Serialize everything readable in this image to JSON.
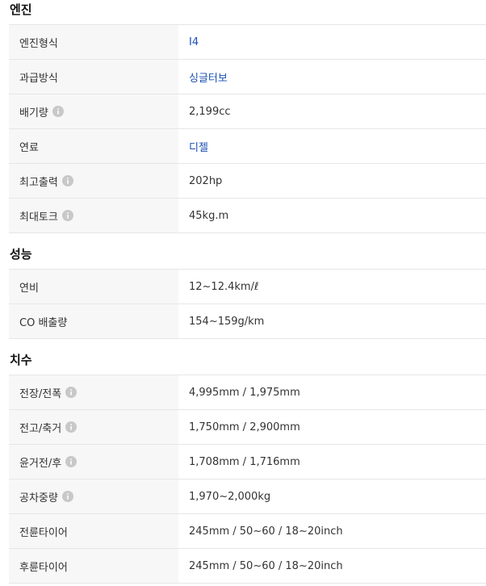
{
  "sections": [
    {
      "title": "엔진",
      "rows": [
        {
          "label": "엔진형식",
          "value": "I4",
          "link": true,
          "info": false
        },
        {
          "label": "과급방식",
          "value": "싱글터보",
          "link": true,
          "info": false
        },
        {
          "label": "배기량",
          "value": "2,199cc",
          "link": false,
          "info": true
        },
        {
          "label": "연료",
          "value": "디젤",
          "link": true,
          "info": false
        },
        {
          "label": "최고출력",
          "value": "202hp",
          "link": false,
          "info": true
        },
        {
          "label": "최대토크",
          "value": "45kg.m",
          "link": false,
          "info": true
        }
      ]
    },
    {
      "title": "성능",
      "rows": [
        {
          "label": "연비",
          "value": "12~12.4km/ℓ",
          "link": false,
          "info": false
        },
        {
          "label": "CO 배출량",
          "value": "154~159g/km",
          "link": false,
          "info": false
        }
      ]
    },
    {
      "title": "치수",
      "rows": [
        {
          "label": "전장/전폭",
          "value": "4,995mm / 1,975mm",
          "link": false,
          "info": true
        },
        {
          "label": "전고/축거",
          "value": "1,750mm / 2,900mm",
          "link": false,
          "info": true
        },
        {
          "label": "윤거전/후",
          "value": "1,708mm / 1,716mm",
          "link": false,
          "info": true
        },
        {
          "label": "공차중량",
          "value": "1,970~2,000kg",
          "link": false,
          "info": true
        },
        {
          "label": "전륜타이어",
          "value": "245mm / 50~60 / 18~20inch",
          "link": false,
          "info": false
        },
        {
          "label": "후륜타이어",
          "value": "245mm / 50~60 / 18~20inch",
          "link": false,
          "info": false
        }
      ]
    }
  ],
  "colors": {
    "label_bg": "#f7f7f7",
    "link": "#1a4fb5",
    "border": "#e6e6e6",
    "info_icon": "#c8c8c8"
  },
  "icons": {
    "info": "info-circle-icon"
  }
}
